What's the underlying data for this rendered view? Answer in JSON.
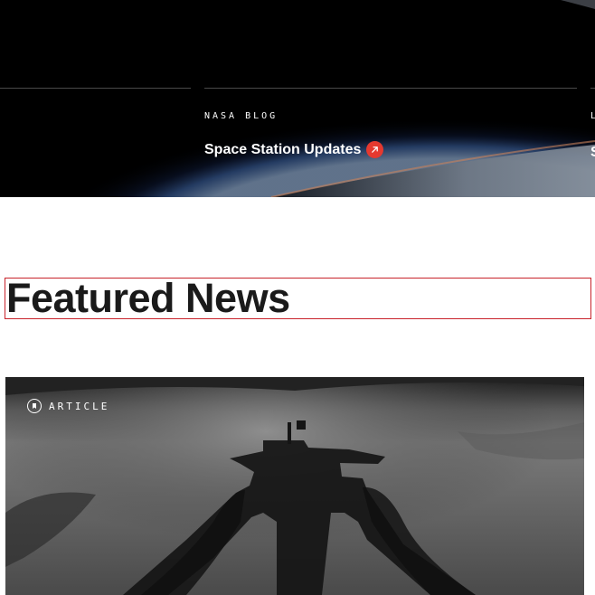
{
  "hero": {
    "blog_card": {
      "eyebrow": "NASA BLOG",
      "title": "Space Station Updates",
      "arrow_icon": "arrow-up-right-icon"
    },
    "next_card": {
      "eyebrow": "L",
      "title": "S"
    }
  },
  "featured": {
    "heading": "Featured News"
  },
  "article_card": {
    "tag_icon": "bookmark-icon",
    "tag_label": "ARTICLE",
    "image": "rover-shadow-on-mars"
  },
  "colors": {
    "accent_red": "#e5392f",
    "heading_text": "#1a1a1a",
    "hero_bg": "#000000",
    "focus_outline": "#c8232b"
  }
}
